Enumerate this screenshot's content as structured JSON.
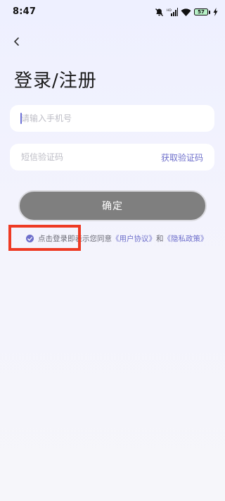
{
  "status_bar": {
    "time": "8:47",
    "battery": "57"
  },
  "header": {
    "title": "登录/注册"
  },
  "form": {
    "phone_placeholder": "请输入手机号",
    "code_placeholder": "短信验证码",
    "get_code_label": "获取验证码",
    "confirm_label": "确定"
  },
  "agreement": {
    "checked": true,
    "prefix": "点击登录即表示您同意",
    "user_agreement": "《用户协议》",
    "conjunction": "和",
    "privacy_policy": "《隐私政策》"
  },
  "colors": {
    "accent": "#6E6FCB",
    "button": "#7F7F7F",
    "highlight": "#EE3A24"
  },
  "icons": [
    "mute-bell-icon",
    "signal-icon",
    "wifi-icon",
    "battery-icon",
    "charging-icon",
    "back-arrow-icon",
    "check-icon"
  ]
}
